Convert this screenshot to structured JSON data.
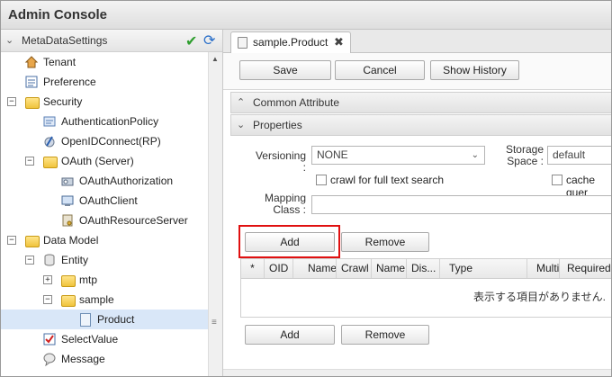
{
  "app": {
    "title": "Admin Console"
  },
  "left_panel": {
    "header": "MetaDataSettings",
    "tree": [
      {
        "label": "Tenant",
        "icon": "house-icon"
      },
      {
        "label": "Preference",
        "icon": "list-icon"
      },
      {
        "label": "Security",
        "icon": "folder-icon",
        "expander": "⊟"
      },
      {
        "label": "AuthenticationPolicy",
        "icon": "policy-icon"
      },
      {
        "label": "OpenIDConnect(RP)",
        "icon": "openid-icon"
      },
      {
        "label": "OAuth (Server)",
        "icon": "folder-icon",
        "expander": "⊟"
      },
      {
        "label": "OAuthAuthorization",
        "icon": "key-icon"
      },
      {
        "label": "OAuthClient",
        "icon": "client-icon"
      },
      {
        "label": "OAuthResourceServer",
        "icon": "server-icon"
      },
      {
        "label": "Data Model",
        "icon": "folder-icon",
        "expander": "⊟"
      },
      {
        "label": "Entity",
        "icon": "database-icon",
        "expander": "⊟"
      },
      {
        "label": "mtp",
        "icon": "folder-icon",
        "expander": "⊞"
      },
      {
        "label": "sample",
        "icon": "folder-icon",
        "expander": "⊟"
      },
      {
        "label": "Product",
        "icon": "document-icon"
      },
      {
        "label": "SelectValue",
        "icon": "checklist-icon"
      },
      {
        "label": "Message",
        "icon": "message-icon"
      }
    ]
  },
  "editor": {
    "tab": "sample.Product",
    "toolbar": {
      "save": "Save",
      "cancel": "Cancel",
      "show_history": "Show History"
    },
    "common_attribute": "Common Attribute",
    "properties": "Properties",
    "versioning_label": "Versioning :",
    "versioning_value": "NONE",
    "storage_space_label": "Storage Space :",
    "storage_space_value": "default",
    "crawl_label": "crawl for full text search",
    "cache_label": "cache quer",
    "mapping_class_label": "Mapping Class :",
    "add": "Add",
    "remove": "Remove",
    "columns": [
      "*",
      "OID",
      "Name",
      "Crawl",
      "Name",
      "Dis...",
      "Type",
      "Multi",
      "Required"
    ],
    "empty_message": "表示する項目がありません."
  },
  "colors": {
    "highlight": "#e01010",
    "selected_row": "#d9e7f8",
    "check": "#2f9e2f"
  }
}
